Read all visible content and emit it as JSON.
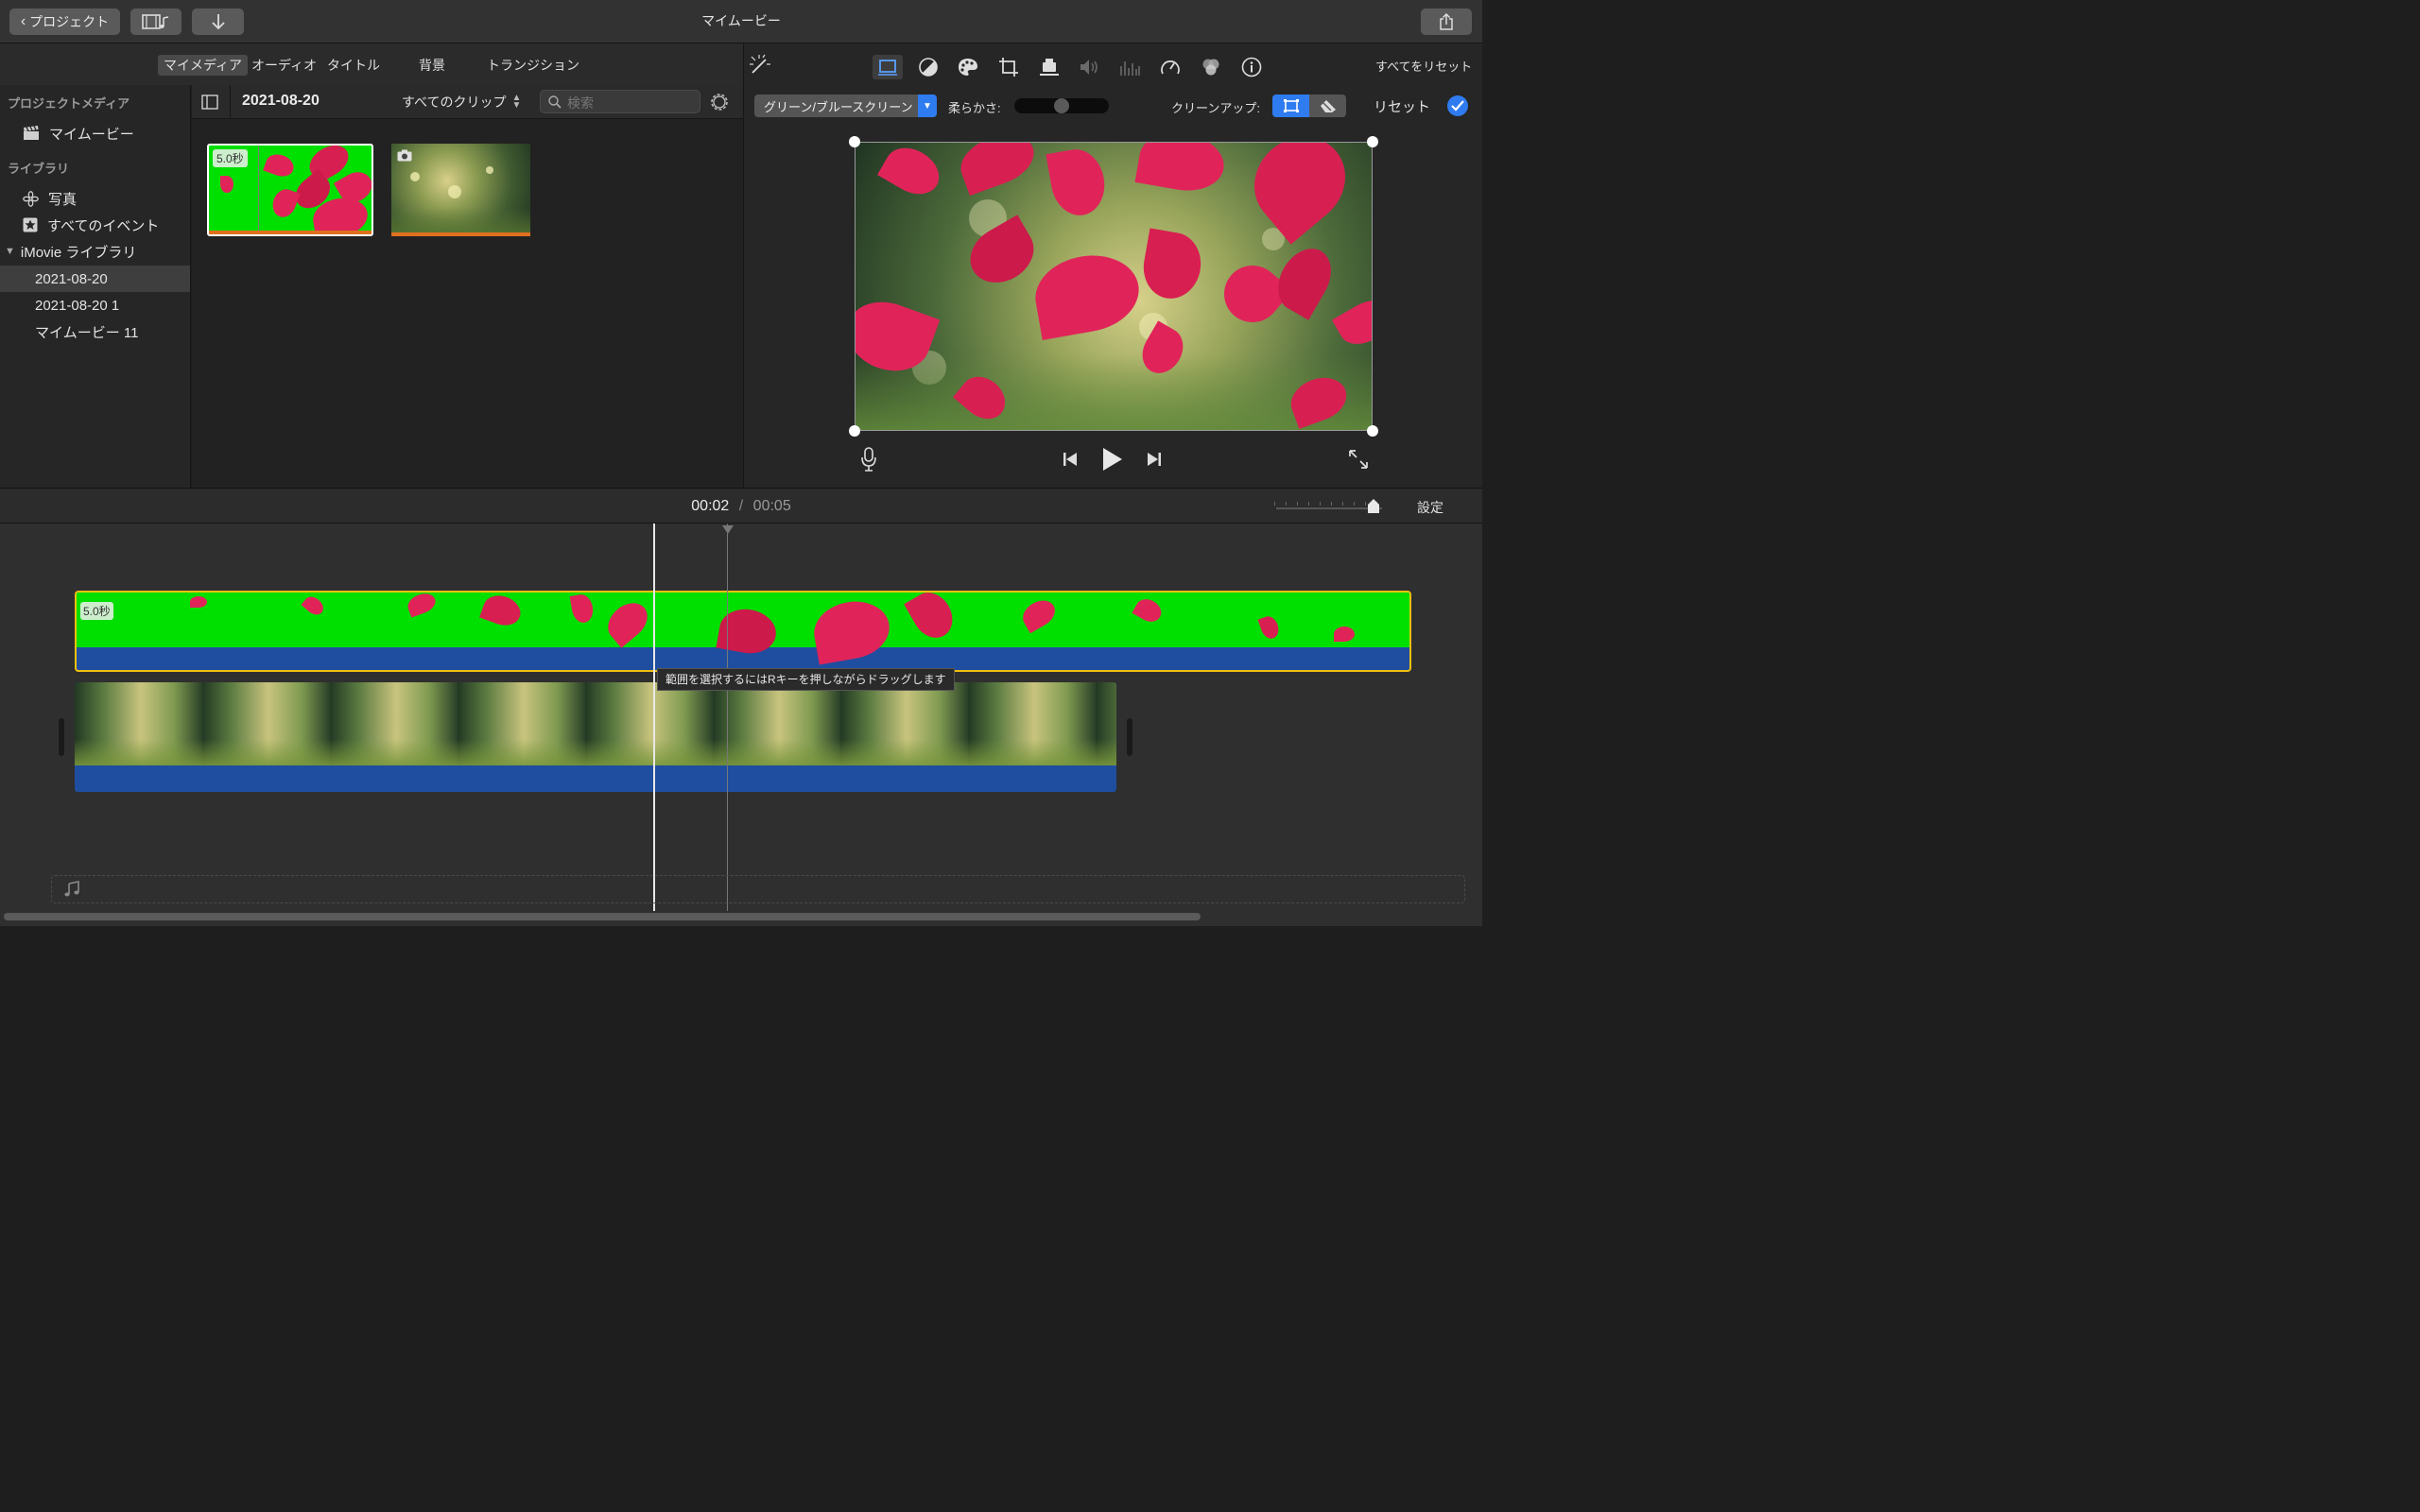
{
  "window": {
    "title": "マイムービー"
  },
  "titlebar": {
    "back_label": "プロジェクト"
  },
  "browser": {
    "tabs": [
      {
        "label": "マイメディア",
        "selected": true
      },
      {
        "label": "オーディオ"
      },
      {
        "label": "タイトル"
      },
      {
        "label": "背景"
      },
      {
        "label": "トランジション"
      }
    ],
    "sidebar": {
      "project_media_header": "プロジェクトメディア",
      "project_item": "マイムービー",
      "library_header": "ライブラリ",
      "photos": "写真",
      "all_events": "すべてのイベント",
      "imovie_library": "iMovie ライブラリ",
      "events": [
        "2021-08-20",
        "2021-08-20 1",
        "マイムービー 11"
      ]
    },
    "header": {
      "event_title": "2021-08-20",
      "filter": "すべてのクリップ",
      "search_placeholder": "検索"
    },
    "clips": [
      {
        "duration": "5.0秒"
      },
      {
        "type": "photo"
      }
    ]
  },
  "viewer": {
    "reset_all": "すべてをリセット",
    "effect_select": "グリーン/ブルースクリーン",
    "softness_label": "柔らかさ:",
    "softness_value": 0.5,
    "cleanup_label": "クリーンアップ:",
    "reset_label": "リセット"
  },
  "timeline": {
    "current_time": "00:02",
    "separator": "/",
    "total_time": "00:05",
    "settings_label": "設定",
    "overlay_clip_duration": "5.0秒",
    "tooltip": "範囲を選択するにはRキーを押しながらドラッグします"
  },
  "colors": {
    "chroma_green": "#00e000",
    "petal": "#e0245a",
    "selection_yellow": "#f0c010",
    "audio_blue": "#1f4ea0",
    "accent_blue": "#2f7bf0"
  }
}
